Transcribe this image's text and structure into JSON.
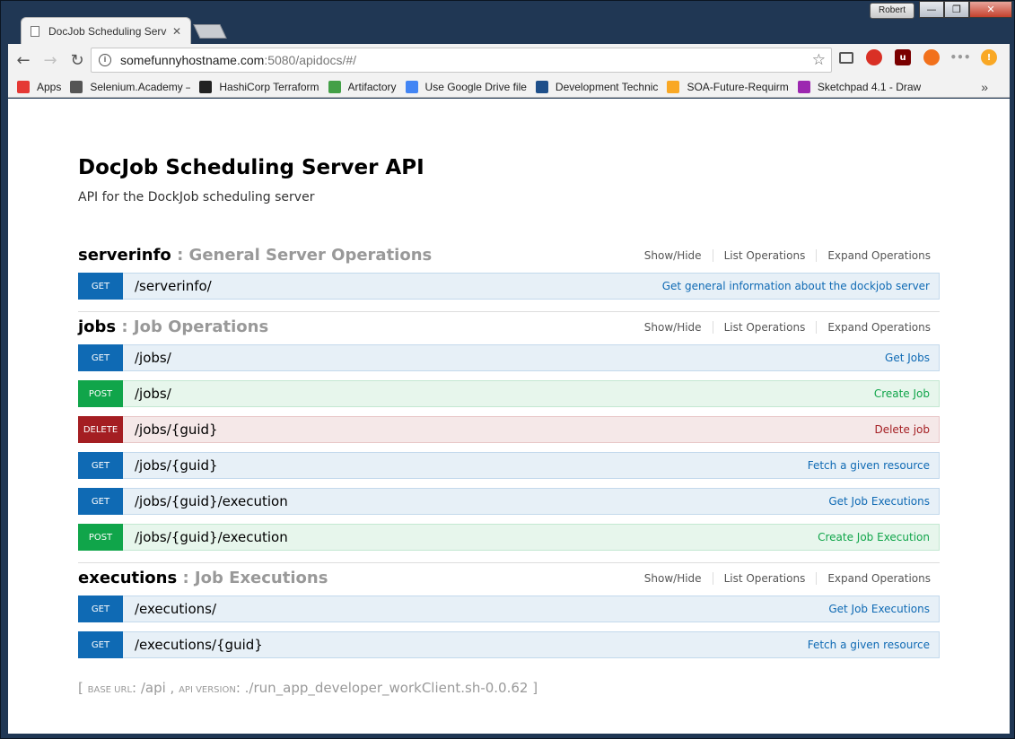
{
  "browser": {
    "user_badge": "Robert",
    "controls": {
      "minimize": "—",
      "maximize": "❐",
      "close": "✕"
    },
    "tab": {
      "title": "DocJob Scheduling Serve",
      "close": "✕"
    },
    "nav": {
      "back": "←",
      "forward": "→",
      "reload": "↻"
    },
    "address": {
      "host": "somefunnyhostname.com",
      "rest": ":5080/apidocs/#/"
    },
    "star": "☆",
    "bookmarks": [
      {
        "label": "Apps",
        "icon": "apps-grid-icon",
        "color": "#e53935"
      },
      {
        "label": "Selenium.Academy –",
        "icon": "selenium-icon",
        "color": "#555555"
      },
      {
        "label": "HashiCorp Terraform",
        "icon": "hashicorp-icon",
        "color": "#222222"
      },
      {
        "label": "Artifactory",
        "icon": "artifactory-icon",
        "color": "#43a047"
      },
      {
        "label": "Use Google Drive file",
        "icon": "google-icon",
        "color": "#4285f4"
      },
      {
        "label": "Development Technic",
        "icon": "confluence-icon",
        "color": "#1e4f8a"
      },
      {
        "label": "SOA-Future-Requirm",
        "icon": "dollar-icon",
        "color": "#f9a825"
      },
      {
        "label": "Sketchpad 4.1 - Draw",
        "icon": "sketchpad-icon",
        "color": "#9c27b0"
      }
    ],
    "bookmarks_more": "»"
  },
  "api": {
    "title": "DocJob Scheduling Server API",
    "description": "API for the DockJob scheduling server"
  },
  "resources": [
    {
      "name": "serverinfo",
      "desc": ": General Server Operations",
      "links": [
        "Show/Hide",
        "List Operations",
        "Expand Operations"
      ],
      "ops": [
        {
          "verb": "GET",
          "path": "/serverinfo/",
          "summary": "Get general information about the dockjob server"
        }
      ]
    },
    {
      "name": "jobs",
      "desc": ": Job Operations",
      "links": [
        "Show/Hide",
        "List Operations",
        "Expand Operations"
      ],
      "ops": [
        {
          "verb": "GET",
          "path": "/jobs/",
          "summary": "Get Jobs"
        },
        {
          "verb": "POST",
          "path": "/jobs/",
          "summary": "Create Job"
        },
        {
          "verb": "DELETE",
          "path": "/jobs/{guid}",
          "summary": "Delete job"
        },
        {
          "verb": "GET",
          "path": "/jobs/{guid}",
          "summary": "Fetch a given resource"
        },
        {
          "verb": "GET",
          "path": "/jobs/{guid}/execution",
          "summary": "Get Job Executions"
        },
        {
          "verb": "POST",
          "path": "/jobs/{guid}/execution",
          "summary": "Create Job Execution"
        }
      ]
    },
    {
      "name": "executions",
      "desc": ": Job Executions",
      "links": [
        "Show/Hide",
        "List Operations",
        "Expand Operations"
      ],
      "ops": [
        {
          "verb": "GET",
          "path": "/executions/",
          "summary": "Get Job Executions"
        },
        {
          "verb": "GET",
          "path": "/executions/{guid}",
          "summary": "Fetch a given resource"
        }
      ]
    }
  ],
  "footer": {
    "open": "[ ",
    "base_label": "BASE URL",
    "base_value": ": /api , ",
    "version_label": "API VERSION",
    "version_value": ": ./run_app_developer_workClient.sh-0.0.62 ]"
  }
}
